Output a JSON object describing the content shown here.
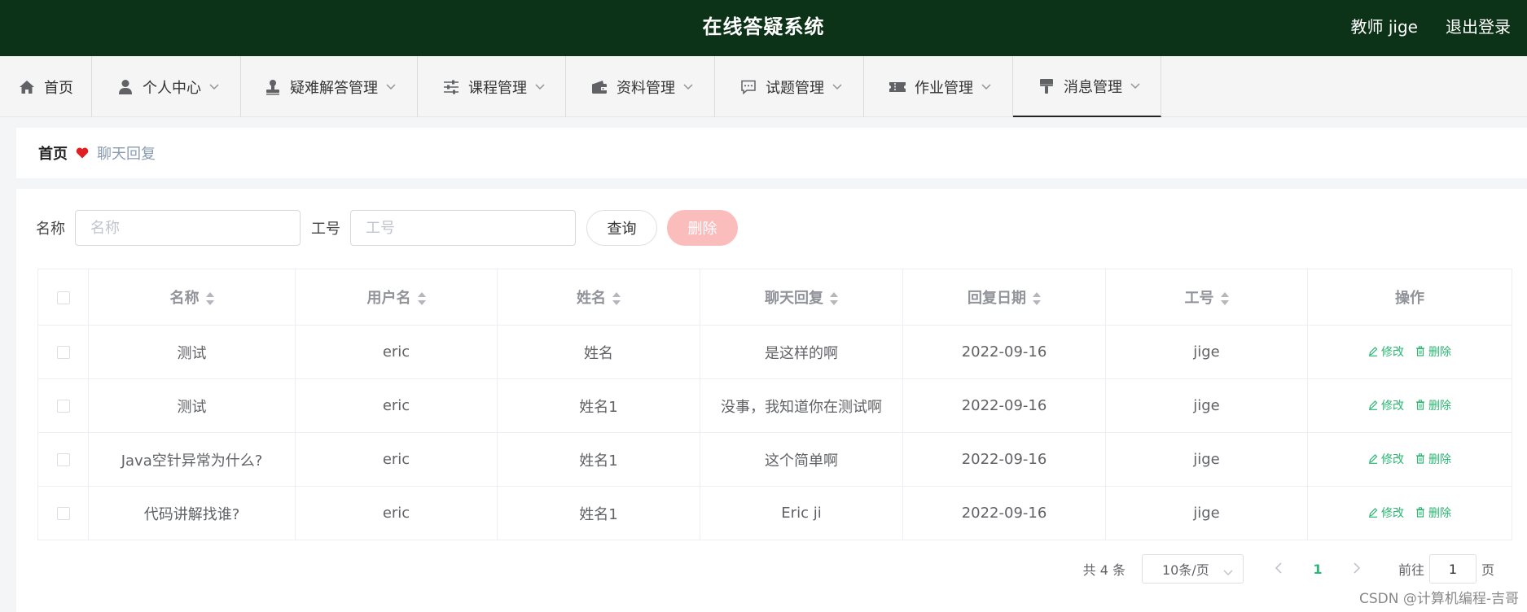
{
  "header": {
    "title": "在线答疑系统",
    "user": "教师 jige",
    "logout": "退出登录"
  },
  "nav": [
    {
      "label": "首页",
      "icon": "home-icon"
    },
    {
      "label": "个人中心",
      "icon": "user-icon"
    },
    {
      "label": "疑难解答管理",
      "icon": "stamp-icon"
    },
    {
      "label": "课程管理",
      "icon": "sliders-icon"
    },
    {
      "label": "资料管理",
      "icon": "wallet-icon"
    },
    {
      "label": "试题管理",
      "icon": "chat-icon"
    },
    {
      "label": "作业管理",
      "icon": "ticket-icon"
    },
    {
      "label": "消息管理",
      "icon": "brush-icon"
    }
  ],
  "breadcrumb": {
    "home": "首页",
    "current": "聊天回复"
  },
  "search": {
    "name_label": "名称",
    "name_placeholder": "名称",
    "id_label": "工号",
    "id_placeholder": "工号",
    "query": "查询",
    "delete": "删除"
  },
  "table": {
    "headers": [
      "名称",
      "用户名",
      "姓名",
      "聊天回复",
      "回复日期",
      "工号",
      "操作"
    ],
    "rows": [
      [
        "测试",
        "eric",
        "姓名",
        "是这样的啊",
        "2022-09-16",
        "jige"
      ],
      [
        "测试",
        "eric",
        "姓名1",
        "没事，我知道你在测试啊",
        "2022-09-16",
        "jige"
      ],
      [
        "Java空针异常为什么?",
        "eric",
        "姓名1",
        "这个简单啊",
        "2022-09-16",
        "jige"
      ],
      [
        "代码讲解找谁?",
        "eric",
        "姓名1",
        "Eric ji",
        "2022-09-16",
        "jige"
      ]
    ],
    "edit": "修改",
    "remove": "删除"
  },
  "pager": {
    "total": "共 4 条",
    "size": "10条/页",
    "current": "1",
    "goto_pre": "前往",
    "goto_val": "1",
    "goto_post": "页"
  },
  "watermark": "CSDN @计算机编程-吉哥",
  "colors": {
    "header": "#0c3217",
    "accent": "#2bb673",
    "delete_btn": "#fbbcbc"
  }
}
